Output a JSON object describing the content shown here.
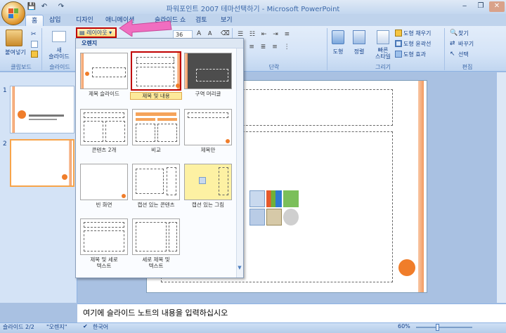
{
  "window": {
    "title": "파워포인트 2007 테마선택하기 - Microsoft PowerPoint",
    "controls": [
      "‒",
      "❐",
      "✕"
    ]
  },
  "qat": [
    "💾",
    "↶",
    "↷"
  ],
  "tabs": [
    "홈",
    "삽입",
    "디자인",
    "애니메이션",
    "슬라이드 쇼",
    "검토",
    "보기"
  ],
  "ribbon": {
    "clipboard": {
      "paste": "붙여넣기",
      "label": "클립보드"
    },
    "slides": {
      "new_slide": "새",
      "new_slide2": "슬라이드",
      "layout": "레이아웃",
      "label": "슬라이드"
    },
    "font": {
      "size": "36"
    },
    "paragraph": {
      "label": "단락"
    },
    "drawing": {
      "shapes": "도형",
      "arrange": "정렬",
      "quick_styles": "빠른",
      "quick_styles2": "스타일",
      "fill": "도형 채우기",
      "outline": "도형 윤곽선",
      "effects": "도형 효과",
      "label": "그리기"
    },
    "editing": {
      "find": "찾기",
      "replace": "바꾸기",
      "select": "선택",
      "label": "편집"
    }
  },
  "layout_menu": {
    "section": "오렌지",
    "items": [
      "제목 슬라이드",
      "제목 및 내용",
      "구역 머리글",
      "콘텐츠 2개",
      "비교",
      "제목만",
      "빈 화면",
      "캡션 있는 콘텐츠",
      "캡션 있는 그림",
      "제목 및 세로\n텍스트",
      "세로 제목 및\n텍스트"
    ],
    "selected_index": 1
  },
  "thumbnails": [
    "1",
    "2"
  ],
  "notes_placeholder": "여기에 슬라이드 노트의 내용을 입력하십시오",
  "status": {
    "slide": "슬라이드 2/2",
    "theme": "\"오렌지\"",
    "lang": "한국어",
    "zoom": "60%"
  },
  "colors": {
    "accent": "#f07d2a",
    "selection": "#c00000",
    "arrow": "#f06ec0"
  }
}
